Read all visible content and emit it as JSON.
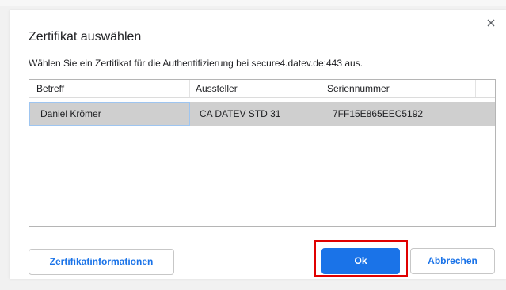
{
  "dialog": {
    "title": "Zertifikat auswählen",
    "subtitle": "Wählen Sie ein Zertifikat für die Authentifizierung bei secure4.datev.de:443 aus.",
    "close_icon": "close-icon"
  },
  "table": {
    "headers": [
      "Betreff",
      "Aussteller",
      "Seriennummer"
    ],
    "rows": [
      {
        "subject": "Daniel Krömer",
        "issuer": "CA DATEV STD 31",
        "serial": "7FF15E865EEC5192",
        "selected": true
      }
    ]
  },
  "buttons": {
    "info_label": "Zertifikatinformationen",
    "ok_label": "Ok",
    "cancel_label": "Abbrechen"
  },
  "colors": {
    "accent": "#1a73e8",
    "selection": "#cfcfcf",
    "highlight_box": "#e00000"
  }
}
